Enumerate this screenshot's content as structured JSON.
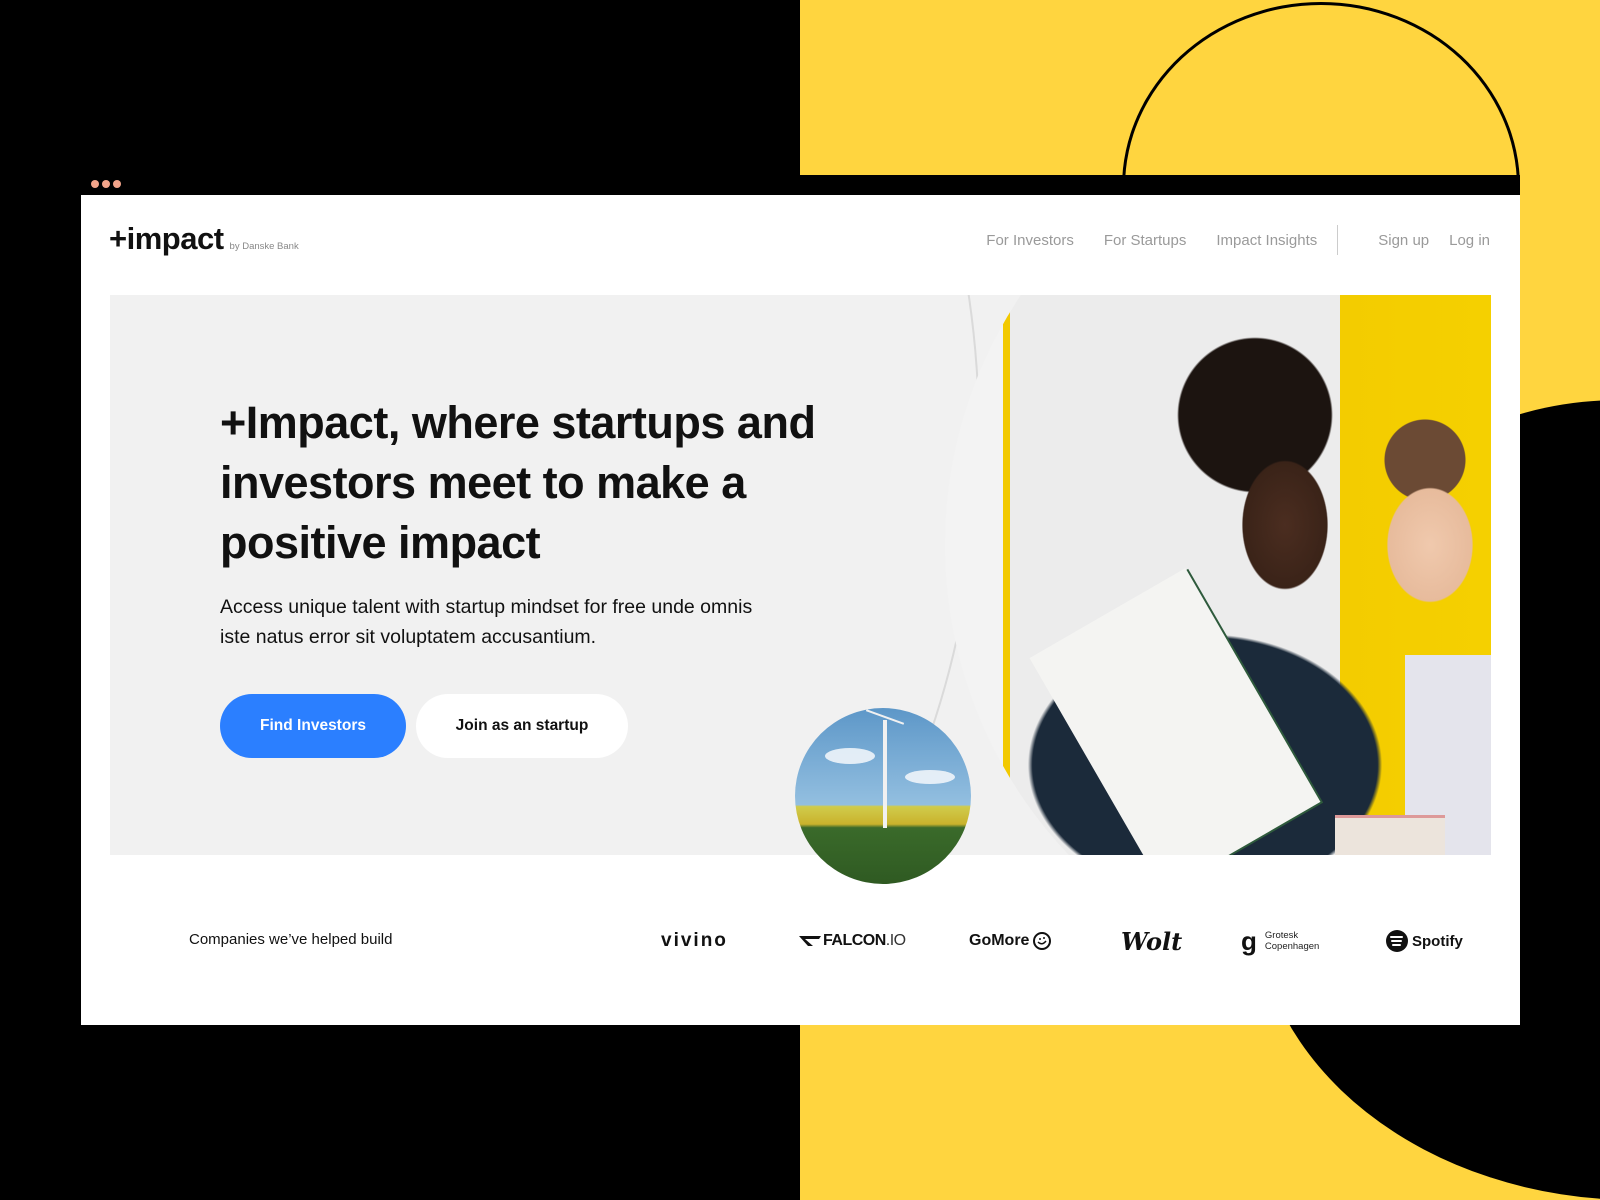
{
  "colors": {
    "yellow": "#FFD53F",
    "black": "#000000",
    "primary_button": "#2B7FFF",
    "window_dots": "#F2A48A",
    "hero_bg": "#F1F1F1",
    "nav_text": "#9A9A9A"
  },
  "header": {
    "logo": "+impact",
    "logo_sub": "by Danske Bank",
    "nav": [
      {
        "label": "For Investors"
      },
      {
        "label": "For Startups"
      },
      {
        "label": "Impact Insights"
      }
    ],
    "auth": [
      {
        "label": "Sign up"
      },
      {
        "label": "Log in"
      }
    ]
  },
  "hero": {
    "headline": "+Impact, where startups and investors meet to make a positive impact",
    "subtext": "Access unique talent with startup mindset for free unde omnis iste natus error sit voluptatem accusantium.",
    "primary_button": "Find Investors",
    "secondary_button": "Join as an startup",
    "images": [
      {
        "name": "people-meeting-photo",
        "description": "Two people smiling at a meeting"
      },
      {
        "name": "wind-turbine-photo",
        "description": "Wind turbine over green field"
      }
    ]
  },
  "companies": {
    "label": "Companies we’ve helped build",
    "logos": [
      {
        "name": "vivino",
        "text": "vivino"
      },
      {
        "name": "falcon",
        "text": "FALCON",
        "suffix": ".IO"
      },
      {
        "name": "gomore",
        "text": "GoMore"
      },
      {
        "name": "wolt",
        "text": "Wolt"
      },
      {
        "name": "grotesk",
        "glyph": "g",
        "line1": "Grotesk",
        "line2": "Copenhagen"
      },
      {
        "name": "spotify",
        "text": "Spotify"
      }
    ]
  }
}
